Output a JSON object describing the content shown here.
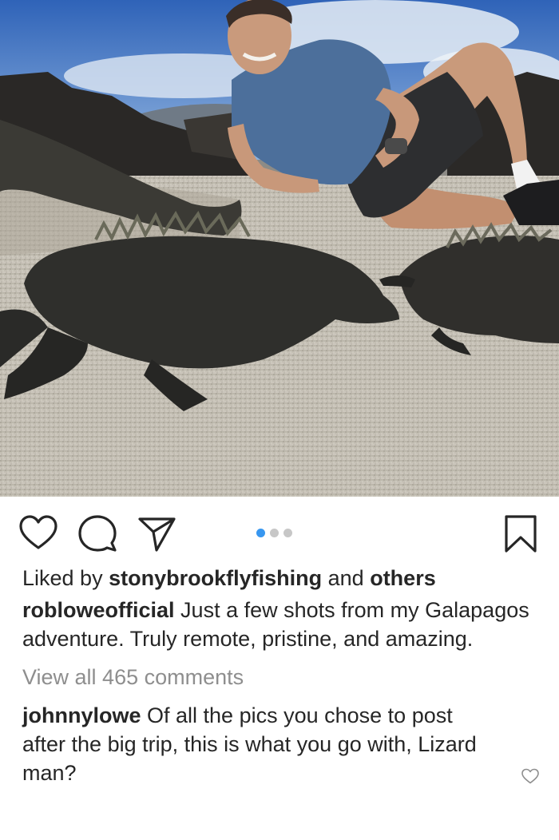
{
  "post": {
    "image_alt": "Man lying on a beach with marine iguanas"
  },
  "actions": {
    "like_icon": "heart-icon",
    "comment_icon": "comment-bubble-icon",
    "share_icon": "paper-plane-icon",
    "save_icon": "bookmark-icon",
    "carousel_dots_total": 3,
    "carousel_active_index": 0,
    "active_dot_color": "#3897f0"
  },
  "likes": {
    "prefix": "Liked by",
    "user": "stonybrookflyfishing",
    "connector": "and",
    "others": "others"
  },
  "caption": {
    "username": "robloweofficial",
    "text": "Just a few shots from my Galapagos adventure. Truly remote, pristine, and amazing."
  },
  "comments_link": "View all 465 comments",
  "comment": {
    "username": "johnnylowe",
    "text": "Of all the pics you chose to post after the big trip, this is what you go with, Lizard man?",
    "like_icon": "small-heart-icon"
  }
}
